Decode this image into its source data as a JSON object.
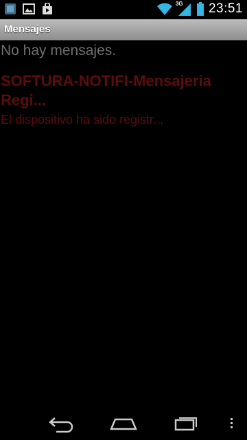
{
  "status_bar": {
    "time": "23:51",
    "network_type": "3G",
    "notification_icons": [
      "notification-app-icon",
      "image-icon",
      "shopping-bag-icon"
    ],
    "status_icons": [
      "wifi-icon",
      "signal-icon",
      "battery-icon"
    ]
  },
  "action_bar": {
    "title": "Mensajes"
  },
  "content": {
    "empty_text": "No hay mensajes.",
    "messages": [
      {
        "title": "SOFTURA-NOTIFI-Mensajeria Regi...",
        "body": "El dispositivo ha sido registr..."
      }
    ]
  },
  "nav_bar": {
    "buttons": [
      "back-icon",
      "home-icon",
      "recent-apps-icon",
      "menu-icon"
    ]
  },
  "colors": {
    "background": "#000000",
    "message_text": "#5c0c0c",
    "empty_text": "#6e6e6e",
    "status_accent": "#33b5e5"
  }
}
